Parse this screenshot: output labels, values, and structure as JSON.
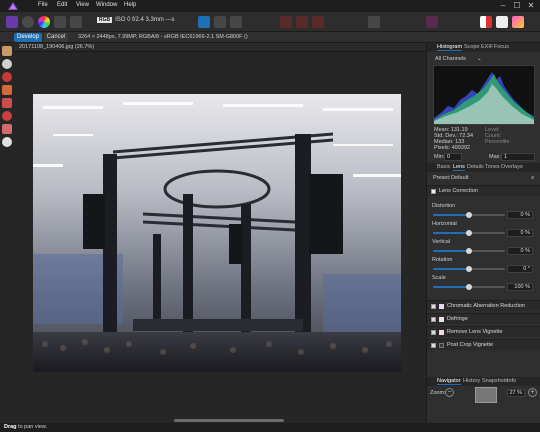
{
  "menu": [
    "File",
    "Edit",
    "View",
    "Window",
    "Help"
  ],
  "toolbar": {
    "rgb_badge": "RGB",
    "camera_info": "ISO 0  f/2.4  3.3mm  ---s"
  },
  "context": {
    "develop_label": "Develop",
    "cancel_label": "Cancel",
    "image_info": "3264 × 2448px, 7.99MP, RGBA/8 - sRGB IEC61966-2.1     SM-G800F ()"
  },
  "document": {
    "tab_title": "20171108_190406.jpg (26.7%)"
  },
  "histogram": {
    "tabs": [
      "Histogram",
      "Scope",
      "EXIF",
      "Focus"
    ],
    "channel": "All Channels",
    "stats_left": [
      "Mean: 131.19",
      "Std. Dev.: 72.34",
      "Median: 133",
      "Pixels: 499392"
    ],
    "stats_right": [
      "Level:",
      "Count:",
      "Percentile:"
    ],
    "min_label": "Min:",
    "min_value": "0",
    "max_label": "Max:",
    "max_value": "1"
  },
  "develop_tabs": [
    "Basic",
    "Lens",
    "Details",
    "Tones",
    "Overlays"
  ],
  "lens": {
    "preset_label": "Preset:",
    "preset_value": "Default",
    "section_title": "Lens Correction",
    "controls": [
      {
        "label": "Distortion",
        "value": "0 %",
        "level": 0.5
      },
      {
        "label": "Horizontal",
        "value": "0 %",
        "level": 0.5
      },
      {
        "label": "Vertical",
        "value": "0 %",
        "level": 0.5
      },
      {
        "label": "Rotation",
        "value": "0 °",
        "level": 0.5
      },
      {
        "label": "Scale",
        "value": "100 %",
        "level": 0.5
      }
    ],
    "sections": [
      "Chromatic Aberration Reduction",
      "Defringe",
      "Remove Lens Vignette",
      "Post Crop Vignette"
    ]
  },
  "navigator": {
    "tabs": [
      "Navigator",
      "History",
      "Snapshots",
      "Info"
    ],
    "zoom_label": "Zoom:",
    "zoom_value": "27 %"
  },
  "status": {
    "action": "Drag",
    "text": "to pan view."
  },
  "colors": {
    "accent": "#1f6fb5",
    "background": "#2b2b2b",
    "panel": "#2f2f2f"
  }
}
